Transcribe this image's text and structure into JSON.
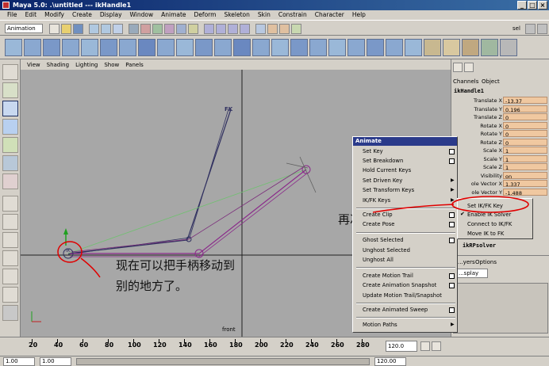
{
  "window": {
    "title": "Maya 5.0: .\\untitled  ---  ikHandle1"
  },
  "menubar": [
    "File",
    "Edit",
    "Modify",
    "Create",
    "Display",
    "Window",
    "Animate",
    "Deform",
    "Skeleton",
    "Skin",
    "Constrain",
    "Character",
    "Help"
  ],
  "statusline": {
    "mode": "Animation",
    "right_label": "sel"
  },
  "viewport": {
    "menu": [
      "View",
      "Shading",
      "Lighting",
      "Show",
      "Panels"
    ],
    "camera_label": "front",
    "fk_label": "FK",
    "ik_label": "IK"
  },
  "channelbox": {
    "tabs": [
      "Channels",
      "Object"
    ],
    "node": "ikHandle1",
    "attributes": [
      {
        "label": "Translate X",
        "value": "-13.37"
      },
      {
        "label": "Translate Y",
        "value": "0.196"
      },
      {
        "label": "Translate Z",
        "value": "0"
      },
      {
        "label": "Rotate X",
        "value": "0"
      },
      {
        "label": "Rotate Y",
        "value": "0"
      },
      {
        "label": "Rotate Z",
        "value": "0"
      },
      {
        "label": "Scale X",
        "value": "1"
      },
      {
        "label": "Scale Y",
        "value": "1"
      },
      {
        "label": "Scale Z",
        "value": "1"
      },
      {
        "label": "Visibility",
        "value": "on"
      },
      {
        "label": "ole Vector X",
        "value": "1.337"
      },
      {
        "label": "ole Vector Y",
        "value": "-1.488"
      }
    ],
    "solver": "ikRPsolver",
    "layer_tabs": [
      "...yers",
      "Options"
    ],
    "layer_mode": "...splay"
  },
  "popup": {
    "title": "Animate",
    "items": [
      {
        "label": "Set Key",
        "option": true
      },
      {
        "label": "Set Breakdown",
        "option": true
      },
      {
        "label": "Hold Current Keys",
        "option": false
      },
      {
        "label": "Set Driven Key",
        "option": false,
        "submenu": true
      },
      {
        "label": "Set Transform Keys",
        "option": false,
        "submenu": true
      },
      {
        "label": "IK/FK Keys",
        "option": false,
        "submenu": true
      },
      {
        "label": "Create Clip",
        "option": true
      },
      {
        "label": "Create Pose",
        "option": true
      },
      {
        "label": "Ghost Selected",
        "option": true
      },
      {
        "label": "Unghost Selected",
        "option": false
      },
      {
        "label": "Unghost All",
        "option": false
      },
      {
        "label": "Create Motion Trail",
        "option": true
      },
      {
        "label": "Create Animation Snapshot",
        "option": true
      },
      {
        "label": "Update Motion Trail/Snapshot",
        "option": false
      },
      {
        "label": "Create Animated Sweep",
        "option": true
      },
      {
        "label": "Motion Paths",
        "option": false,
        "submenu": true
      }
    ]
  },
  "submenu": {
    "items": [
      "Set IK/FK Key",
      "Enable IK Solver",
      "Connect to IK/FK",
      "Move IK to FK"
    ],
    "checked": "Enable IK Solver"
  },
  "annotations": {
    "note1": "再次记录。",
    "note2_line1": "现在可以把手柄移动到",
    "note2_line2": "别的地方了。",
    "highlight_color": "#e00000"
  },
  "timeslider": {
    "ticks": [
      "20",
      "40",
      "60",
      "80",
      "100",
      "120",
      "140",
      "160",
      "180",
      "200",
      "220",
      "240",
      "260",
      "280"
    ],
    "right_value": "120.0",
    "start": "1.00",
    "end": "1.00",
    "range_end": "120.00"
  }
}
